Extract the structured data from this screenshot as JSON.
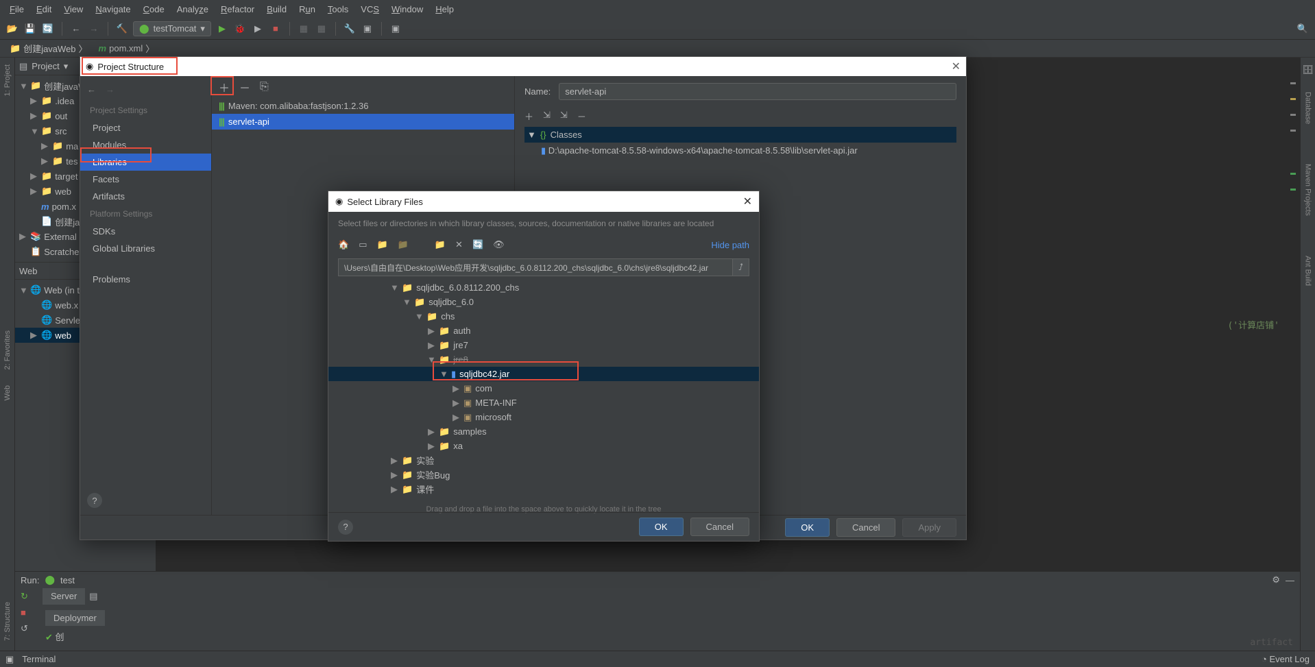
{
  "menu": {
    "file": "File",
    "edit": "Edit",
    "view": "View",
    "navigate": "Navigate",
    "code": "Code",
    "analyze": "Analyze",
    "refactor": "Refactor",
    "build": "Build",
    "run": "Run",
    "tools": "Tools",
    "vcs": "VCS",
    "window": "Window",
    "help": "Help"
  },
  "toolbar": {
    "run_config": "testTomcat"
  },
  "breadcrumb": {
    "root": "创建javaWeb",
    "file": "pom.xml"
  },
  "left_gutter": {
    "project": "1: Project",
    "favorites": "2: Favorites",
    "web": "Web",
    "structure": "7: Structure"
  },
  "right_gutter": {
    "database": "Database",
    "maven": "Maven Projects",
    "ant": "Ant Build"
  },
  "project": {
    "header": "Project",
    "items": [
      {
        "label": "创建javaWeb",
        "indent": 0,
        "arrow": "▼",
        "icon": "folder"
      },
      {
        "label": ".idea",
        "indent": 1,
        "arrow": "▶",
        "icon": "folder"
      },
      {
        "label": "out",
        "indent": 1,
        "arrow": "▶",
        "icon": "folder-orange"
      },
      {
        "label": "src",
        "indent": 1,
        "arrow": "▼",
        "icon": "folder-blue"
      },
      {
        "label": "ma",
        "indent": 2,
        "arrow": "▶",
        "icon": "folder"
      },
      {
        "label": "tes",
        "indent": 2,
        "arrow": "▶",
        "icon": "folder"
      },
      {
        "label": "target",
        "indent": 1,
        "arrow": "▶",
        "icon": "folder-orange"
      },
      {
        "label": "web",
        "indent": 1,
        "arrow": "▶",
        "icon": "folder"
      },
      {
        "label": "pom.x",
        "indent": 1,
        "arrow": "",
        "icon": "m"
      },
      {
        "label": "创建ja",
        "indent": 1,
        "arrow": "",
        "icon": "file"
      },
      {
        "label": "External L",
        "indent": 0,
        "arrow": "▶",
        "icon": "lib"
      },
      {
        "label": "Scratches",
        "indent": 0,
        "arrow": "",
        "icon": "scratch"
      }
    ],
    "web_header": "Web",
    "web_items": [
      {
        "label": "Web (in t",
        "indent": 0,
        "arrow": "▼"
      },
      {
        "label": "web.x",
        "indent": 1,
        "arrow": ""
      },
      {
        "label": "Servle",
        "indent": 1,
        "arrow": ""
      },
      {
        "label": "web",
        "indent": 1,
        "arrow": "▶",
        "sel": true
      }
    ]
  },
  "editor": {
    "snippet": "('计算店铺'"
  },
  "run": {
    "label": "Run:",
    "config": "test",
    "tabs": [
      "Server",
      "Deploymer"
    ],
    "output": "创"
  },
  "status": {
    "terminal": "Terminal",
    "event": "Event Log"
  },
  "ps": {
    "title": "Project Structure",
    "nav": {
      "settings_header": "Project Settings",
      "items": [
        "Project",
        "Modules",
        "Libraries",
        "Facets",
        "Artifacts"
      ],
      "platform_header": "Platform Settings",
      "p_items": [
        "SDKs",
        "Global Libraries"
      ],
      "problems": "Problems"
    },
    "libs": [
      "Maven: com.alibaba:fastjson:1.2.36",
      "servlet-api"
    ],
    "name_label": "Name:",
    "name_value": "servlet-api",
    "classes_label": "Classes",
    "jar_path": "D:\\apache-tomcat-8.5.58-windows-x64\\apache-tomcat-8.5.58\\lib\\servlet-api.jar",
    "buttons": {
      "ok": "OK",
      "cancel": "Cancel",
      "apply": "Apply"
    }
  },
  "slf": {
    "title": "Select Library Files",
    "desc": "Select files or directories in which library classes, sources, documentation or native libraries are located",
    "hide": "Hide path",
    "path": "\\Users\\自由自在\\Desktop\\Web应用开发\\sqljdbc_6.0.8112.200_chs\\sqljdbc_6.0\\chs\\jre8\\sqljdbc42.jar",
    "tree": [
      {
        "label": "sqljdbc_6.0.8112.200_chs",
        "indent": 5,
        "arrow": "▼",
        "icon": "folder"
      },
      {
        "label": "sqljdbc_6.0",
        "indent": 6,
        "arrow": "▼",
        "icon": "folder"
      },
      {
        "label": "chs",
        "indent": 7,
        "arrow": "▼",
        "icon": "folder"
      },
      {
        "label": "auth",
        "indent": 8,
        "arrow": "▶",
        "icon": "folder"
      },
      {
        "label": "jre7",
        "indent": 8,
        "arrow": "▶",
        "icon": "folder"
      },
      {
        "label": "jre8",
        "indent": 8,
        "arrow": "▼",
        "icon": "folder",
        "strike": true
      },
      {
        "label": "sqljdbc42.jar",
        "indent": 9,
        "arrow": "▼",
        "icon": "jar",
        "sel": true
      },
      {
        "label": "com",
        "indent": 10,
        "arrow": "▶",
        "icon": "pkg"
      },
      {
        "label": "META-INF",
        "indent": 10,
        "arrow": "▶",
        "icon": "pkg"
      },
      {
        "label": "microsoft",
        "indent": 10,
        "arrow": "▶",
        "icon": "pkg"
      },
      {
        "label": "samples",
        "indent": 8,
        "arrow": "▶",
        "icon": "folder"
      },
      {
        "label": "xa",
        "indent": 8,
        "arrow": "▶",
        "icon": "folder"
      },
      {
        "label": "实验",
        "indent": 5,
        "arrow": "▶",
        "icon": "folder"
      },
      {
        "label": "实验Bug",
        "indent": 5,
        "arrow": "▶",
        "icon": "folder"
      },
      {
        "label": "课件",
        "indent": 5,
        "arrow": "▶",
        "icon": "folder"
      }
    ],
    "hint": "Drag and drop a file into the space above to quickly locate it in the tree",
    "ok": "OK",
    "cancel": "Cancel"
  }
}
